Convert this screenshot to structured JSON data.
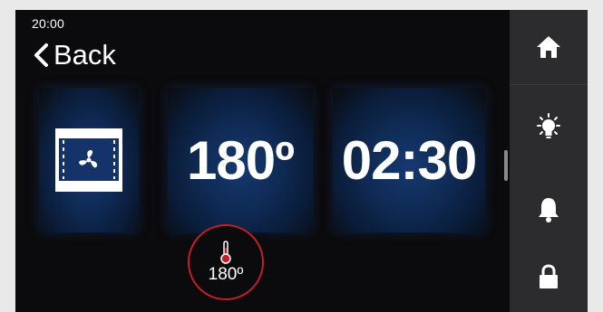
{
  "status": {
    "time": "20:00"
  },
  "nav": {
    "back_label": "Back",
    "back_icon": "chevron-left-icon"
  },
  "mode": {
    "icon": "fan-convection-icon"
  },
  "temperature": {
    "value": "180º"
  },
  "timer": {
    "value": "02:30"
  },
  "core_probe": {
    "icon": "thermometer-icon",
    "value": "180º",
    "ring_color": "#c21f26"
  },
  "sidebar": {
    "items": [
      {
        "name": "home",
        "icon": "home-icon"
      },
      {
        "name": "light",
        "icon": "lightbulb-icon"
      },
      {
        "name": "alarm",
        "icon": "bell-icon"
      },
      {
        "name": "lock",
        "icon": "lock-icon"
      }
    ]
  },
  "colors": {
    "background": "#0b0b0d",
    "tile_glow": "#16396f",
    "sidebar": "#2c2c2e",
    "accent_red": "#c21f26",
    "text": "#ffffff"
  }
}
